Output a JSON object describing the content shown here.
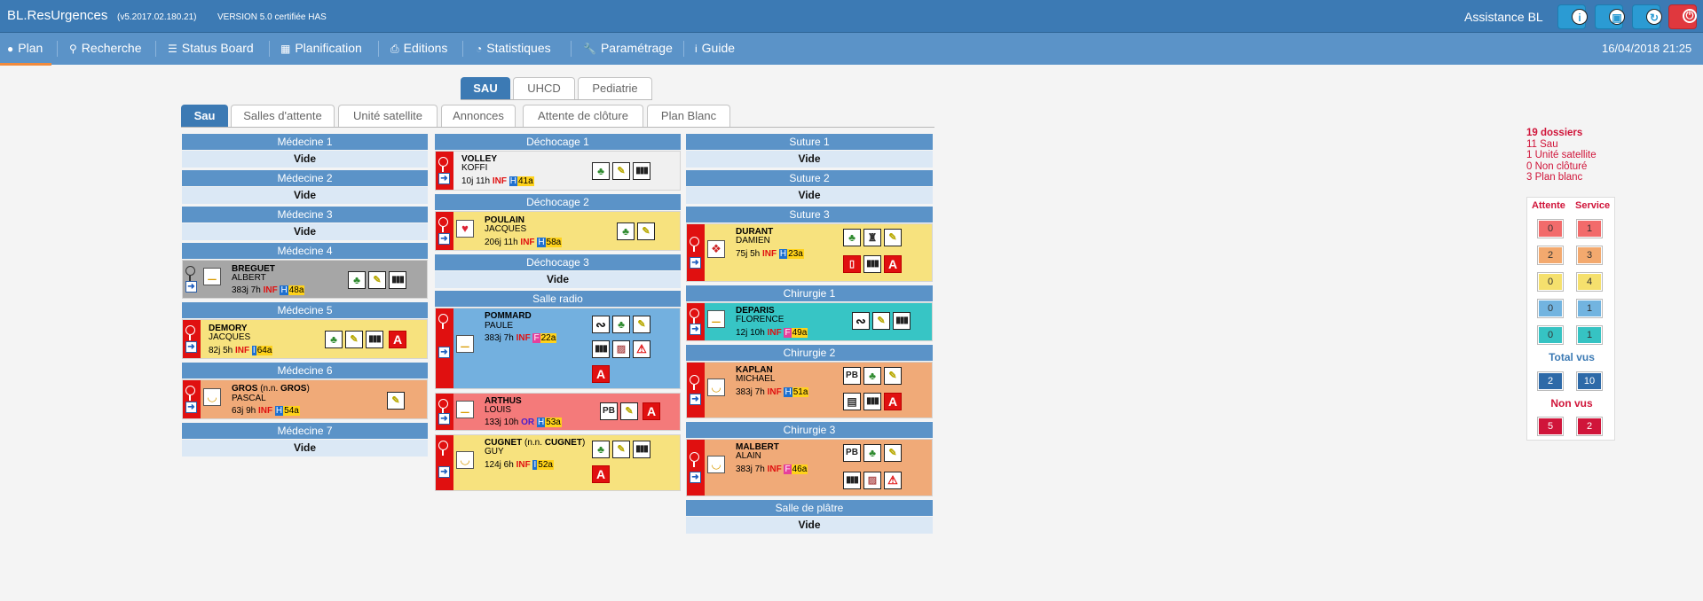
{
  "topbar": {
    "title": "BL.ResUrgences",
    "version": "(v5.2017.02.180.21)",
    "cert": "VERSION 5.0 certifiée HAS",
    "user": "Assistance BL"
  },
  "nav": {
    "items": [
      "Plan",
      "Recherche",
      "Status Board",
      "Planification",
      "Editions",
      "Statistiques",
      "Paramétrage",
      "Guide"
    ],
    "date": "16/04/2018 21:25"
  },
  "tabs_top": [
    "SAU",
    "UHCD",
    "Pediatrie"
  ],
  "tabs_sub": [
    "Sau",
    "Salles d'attente",
    "Unité satellite",
    "Annonces",
    "Attente de clôture",
    "Plan Blanc"
  ],
  "vide": "Vide",
  "rooms": {
    "medecine1": "Médecine 1",
    "medecine2": "Médecine 2",
    "medecine3": "Médecine 3",
    "medecine4": "Médecine 4",
    "medecine5": "Médecine 5",
    "medecine6": "Médecine 6",
    "medecine7": "Médecine 7",
    "dechocage1": "Déchocage 1",
    "dechocage2": "Déchocage 2",
    "dechocage3": "Déchocage 3",
    "salle_radio": "Salle radio",
    "suture1": "Suture 1",
    "suture2": "Suture 2",
    "suture3": "Suture 3",
    "chirurgie1": "Chirurgie 1",
    "chirurgie2": "Chirurgie 2",
    "chirurgie3": "Chirurgie 3",
    "salle_platre": "Salle de plâtre"
  },
  "patients": {
    "breguet": {
      "name": "BREGUET",
      "first": "ALBERT",
      "dur": "383j 7h",
      "inf": "INF",
      "sex": "H",
      "age": "48a"
    },
    "demory": {
      "name": "DEMORY",
      "first": "JACQUES",
      "dur": "82j 5h",
      "inf": "INF",
      "sex": "I",
      "age": "64a"
    },
    "gros": {
      "name": "GROS",
      "nee_prefix": " (n.n. ",
      "nee": "GROS",
      "nee_suffix": ")",
      "first": "PASCAL",
      "dur": "63j 9h",
      "inf": "INF",
      "sex": "H",
      "age": "54a"
    },
    "volley": {
      "name": "VOLLEY",
      "first": "KOFFI",
      "dur": "10j 11h",
      "inf": "INF",
      "sex": "H",
      "age": "41a"
    },
    "poulain": {
      "name": "POULAIN",
      "first": "JACQUES",
      "dur": "206j 11h",
      "inf": "INF",
      "sex": "H",
      "age": "58a"
    },
    "pommard": {
      "name": "POMMARD",
      "first": "PAULE",
      "dur": "383j 7h",
      "inf": "INF",
      "sex": "F",
      "age": "22a"
    },
    "arthus": {
      "name": "ARTHUS",
      "first": "LOUIS",
      "dur": "133j 10h",
      "inf": "OR",
      "sex": "H",
      "age": "53a"
    },
    "cugnet": {
      "name": "CUGNET",
      "nee_prefix": " (n.n. ",
      "nee": "CUGNET",
      "nee_suffix": ")",
      "first": "GUY",
      "dur": "124j 6h",
      "inf": "INF",
      "sex": "I",
      "age": "52a"
    },
    "durant": {
      "name": "DURANT",
      "first": "DAMIEN",
      "dur": "75j 5h",
      "inf": "INF",
      "sex": "H",
      "age": "23a"
    },
    "deparis": {
      "name": "DEPARIS",
      "first": "FLORENCE",
      "dur": "12j 10h",
      "inf": "INF",
      "sex": "F",
      "age": "49a"
    },
    "kaplan": {
      "name": "KAPLAN",
      "first": "MICHAEL",
      "dur": "383j 7h",
      "inf": "INF",
      "sex": "H",
      "age": "51a"
    },
    "malbert": {
      "name": "MALBERT",
      "first": "ALAIN",
      "dur": "383j 7h",
      "inf": "INF",
      "sex": "F",
      "age": "46a"
    }
  },
  "stats": {
    "lines": [
      "19 dossiers",
      "11 Sau",
      "1 Unité satellite",
      "0 Non clôturé",
      "3 Plan blanc"
    ],
    "col_attente": "Attente",
    "col_service": "Service",
    "levels": [
      {
        "attente": "0",
        "service": "1",
        "color": "#f26b6b"
      },
      {
        "attente": "2",
        "service": "3",
        "color": "#f3a96e"
      },
      {
        "attente": "0",
        "service": "4",
        "color": "#f5e06d"
      },
      {
        "attente": "0",
        "service": "1",
        "color": "#72b4e0"
      },
      {
        "attente": "0",
        "service": "1",
        "color": "#36c3c3"
      }
    ],
    "total_label": "Total vus",
    "total": [
      "2",
      "10"
    ],
    "nonvus_label": "Non vus",
    "nonvus": [
      "5",
      "2"
    ]
  }
}
